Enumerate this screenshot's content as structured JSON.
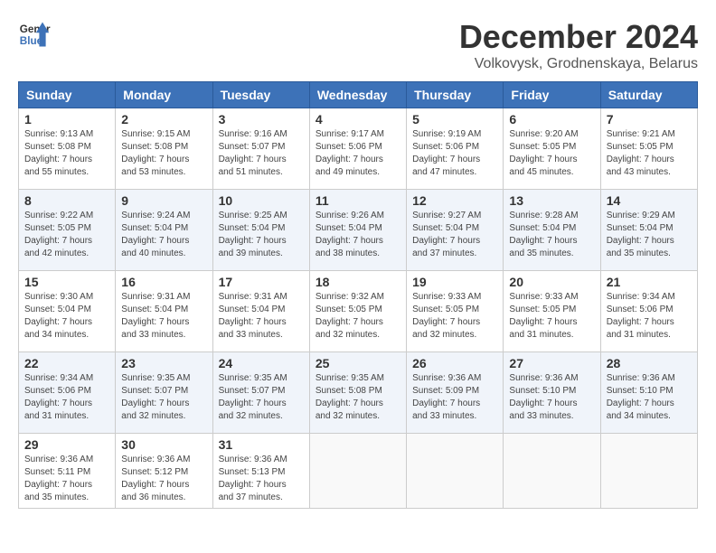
{
  "header": {
    "logo_line1": "General",
    "logo_line2": "Blue",
    "month_title": "December 2024",
    "location": "Volkovysk, Grodnenskaya, Belarus"
  },
  "days_of_week": [
    "Sunday",
    "Monday",
    "Tuesday",
    "Wednesday",
    "Thursday",
    "Friday",
    "Saturday"
  ],
  "weeks": [
    [
      {
        "day": "1",
        "sunrise": "9:13 AM",
        "sunset": "5:08 PM",
        "daylight": "7 hours and 55 minutes."
      },
      {
        "day": "2",
        "sunrise": "9:15 AM",
        "sunset": "5:08 PM",
        "daylight": "7 hours and 53 minutes."
      },
      {
        "day": "3",
        "sunrise": "9:16 AM",
        "sunset": "5:07 PM",
        "daylight": "7 hours and 51 minutes."
      },
      {
        "day": "4",
        "sunrise": "9:17 AM",
        "sunset": "5:06 PM",
        "daylight": "7 hours and 49 minutes."
      },
      {
        "day": "5",
        "sunrise": "9:19 AM",
        "sunset": "5:06 PM",
        "daylight": "7 hours and 47 minutes."
      },
      {
        "day": "6",
        "sunrise": "9:20 AM",
        "sunset": "5:05 PM",
        "daylight": "7 hours and 45 minutes."
      },
      {
        "day": "7",
        "sunrise": "9:21 AM",
        "sunset": "5:05 PM",
        "daylight": "7 hours and 43 minutes."
      }
    ],
    [
      {
        "day": "8",
        "sunrise": "9:22 AM",
        "sunset": "5:05 PM",
        "daylight": "7 hours and 42 minutes."
      },
      {
        "day": "9",
        "sunrise": "9:24 AM",
        "sunset": "5:04 PM",
        "daylight": "7 hours and 40 minutes."
      },
      {
        "day": "10",
        "sunrise": "9:25 AM",
        "sunset": "5:04 PM",
        "daylight": "7 hours and 39 minutes."
      },
      {
        "day": "11",
        "sunrise": "9:26 AM",
        "sunset": "5:04 PM",
        "daylight": "7 hours and 38 minutes."
      },
      {
        "day": "12",
        "sunrise": "9:27 AM",
        "sunset": "5:04 PM",
        "daylight": "7 hours and 37 minutes."
      },
      {
        "day": "13",
        "sunrise": "9:28 AM",
        "sunset": "5:04 PM",
        "daylight": "7 hours and 35 minutes."
      },
      {
        "day": "14",
        "sunrise": "9:29 AM",
        "sunset": "5:04 PM",
        "daylight": "7 hours and 35 minutes."
      }
    ],
    [
      {
        "day": "15",
        "sunrise": "9:30 AM",
        "sunset": "5:04 PM",
        "daylight": "7 hours and 34 minutes."
      },
      {
        "day": "16",
        "sunrise": "9:31 AM",
        "sunset": "5:04 PM",
        "daylight": "7 hours and 33 minutes."
      },
      {
        "day": "17",
        "sunrise": "9:31 AM",
        "sunset": "5:04 PM",
        "daylight": "7 hours and 33 minutes."
      },
      {
        "day": "18",
        "sunrise": "9:32 AM",
        "sunset": "5:05 PM",
        "daylight": "7 hours and 32 minutes."
      },
      {
        "day": "19",
        "sunrise": "9:33 AM",
        "sunset": "5:05 PM",
        "daylight": "7 hours and 32 minutes."
      },
      {
        "day": "20",
        "sunrise": "9:33 AM",
        "sunset": "5:05 PM",
        "daylight": "7 hours and 31 minutes."
      },
      {
        "day": "21",
        "sunrise": "9:34 AM",
        "sunset": "5:06 PM",
        "daylight": "7 hours and 31 minutes."
      }
    ],
    [
      {
        "day": "22",
        "sunrise": "9:34 AM",
        "sunset": "5:06 PM",
        "daylight": "7 hours and 31 minutes."
      },
      {
        "day": "23",
        "sunrise": "9:35 AM",
        "sunset": "5:07 PM",
        "daylight": "7 hours and 32 minutes."
      },
      {
        "day": "24",
        "sunrise": "9:35 AM",
        "sunset": "5:07 PM",
        "daylight": "7 hours and 32 minutes."
      },
      {
        "day": "25",
        "sunrise": "9:35 AM",
        "sunset": "5:08 PM",
        "daylight": "7 hours and 32 minutes."
      },
      {
        "day": "26",
        "sunrise": "9:36 AM",
        "sunset": "5:09 PM",
        "daylight": "7 hours and 33 minutes."
      },
      {
        "day": "27",
        "sunrise": "9:36 AM",
        "sunset": "5:10 PM",
        "daylight": "7 hours and 33 minutes."
      },
      {
        "day": "28",
        "sunrise": "9:36 AM",
        "sunset": "5:10 PM",
        "daylight": "7 hours and 34 minutes."
      }
    ],
    [
      {
        "day": "29",
        "sunrise": "9:36 AM",
        "sunset": "5:11 PM",
        "daylight": "7 hours and 35 minutes."
      },
      {
        "day": "30",
        "sunrise": "9:36 AM",
        "sunset": "5:12 PM",
        "daylight": "7 hours and 36 minutes."
      },
      {
        "day": "31",
        "sunrise": "9:36 AM",
        "sunset": "5:13 PM",
        "daylight": "7 hours and 37 minutes."
      },
      null,
      null,
      null,
      null
    ]
  ],
  "labels": {
    "sunrise": "Sunrise:",
    "sunset": "Sunset:",
    "daylight": "Daylight:"
  }
}
